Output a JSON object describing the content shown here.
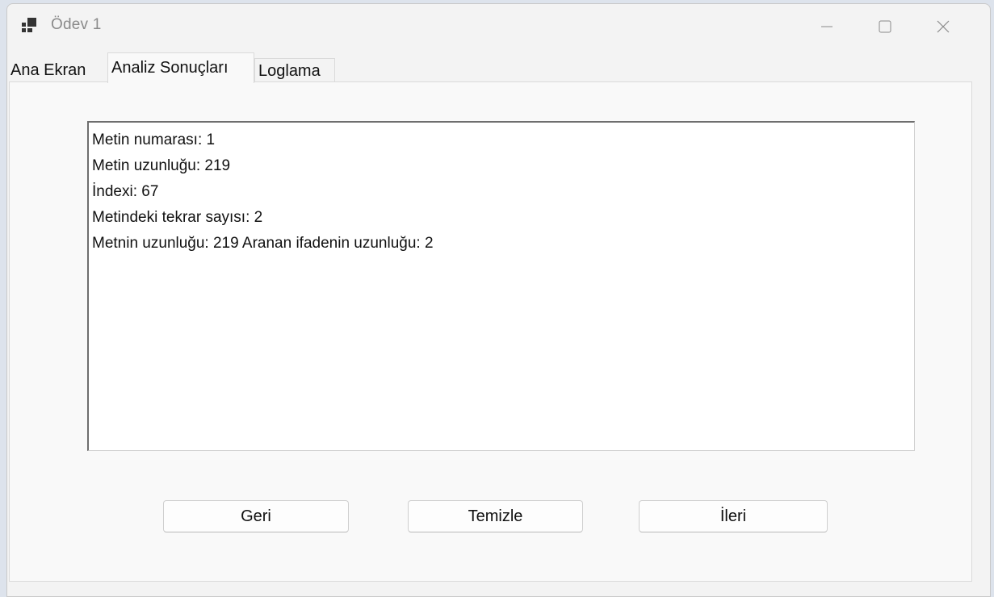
{
  "window": {
    "title": "Ödev 1",
    "app_icon": "app-window-icon"
  },
  "caption": {
    "minimize_icon": "minimize-icon",
    "maximize_icon": "maximize-icon",
    "close_icon": "close-icon"
  },
  "tabs": [
    {
      "label": "Ana Ekran",
      "selected": false
    },
    {
      "label": "Analiz Sonuçları",
      "selected": true
    },
    {
      "label": "Loglama",
      "selected": false
    }
  ],
  "results": {
    "lines": [
      "Metin numarası: 1",
      "Metin uzunluğu: 219",
      "İndexi: 67",
      "Metindeki tekrar sayısı: 2",
      "Metnin uzunluğu: 219 Aranan ifadenin uzunluğu: 2"
    ]
  },
  "buttons": {
    "back_label": "Geri",
    "clear_label": "Temizle",
    "next_label": "İleri"
  },
  "colors": {
    "window_bg": "#f3f3f3",
    "desktop_bg": "#dde3ec",
    "text": "#111111",
    "title_text": "#8a8a8a"
  }
}
